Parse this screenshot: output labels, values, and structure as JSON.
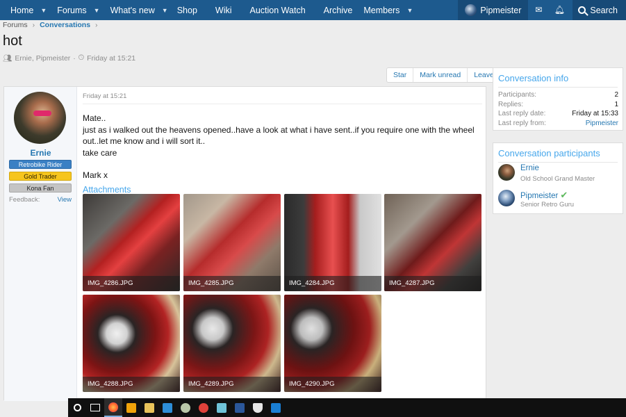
{
  "nav": {
    "items": [
      {
        "label": "Home",
        "dropdown": true
      },
      {
        "label": "Forums",
        "dropdown": true
      },
      {
        "label": "What's new",
        "dropdown": true
      },
      {
        "label": "Shop",
        "dropdown": false
      },
      {
        "label": "Wiki",
        "dropdown": false
      },
      {
        "label": "Auction Watch",
        "dropdown": false
      },
      {
        "label": "Archive",
        "dropdown": false
      },
      {
        "label": "Members",
        "dropdown": true
      }
    ],
    "user": "Pipmeister",
    "search": "Search"
  },
  "breadcrumb": {
    "forums": "Forums",
    "conversations": "Conversations"
  },
  "title": "hot",
  "meta": {
    "participants": "Ernie, Pipmeister",
    "sep": "·",
    "date": "Friday at 15:21"
  },
  "actions": {
    "star": "Star",
    "mark_unread": "Mark unread",
    "leave": "Leave"
  },
  "message": {
    "author": "Ernie",
    "badges": [
      "Retrobike Rider",
      "Gold Trader",
      "Kona Fan"
    ],
    "feedback_label": "Feedback:",
    "feedback_link": "View",
    "date": "Friday at 15:21",
    "lines": [
      "Mate..",
      "just as i walked out the heavens opened..have a look at what i have sent..if you require one with the wheel out..let me know and i will sort it..",
      "take care",
      "",
      "Mark x"
    ],
    "attachments_title": "Attachments",
    "attachments": [
      "IMG_4286.JPG",
      "IMG_4285.JPG",
      "IMG_4284.JPG",
      "IMG_4287.JPG",
      "IMG_4288.JPG",
      "IMG_4289.JPG",
      "IMG_4290.JPG"
    ]
  },
  "info": {
    "title": "Conversation info",
    "rows": [
      {
        "k": "Participants:",
        "v": "2"
      },
      {
        "k": "Replies:",
        "v": "1"
      },
      {
        "k": "Last reply date:",
        "v": "Friday at 15:33"
      },
      {
        "k": "Last reply from:",
        "v": "Pipmeister"
      }
    ]
  },
  "participants": {
    "title": "Conversation participants",
    "list": [
      {
        "name": "Ernie",
        "title": "Old School Grand Master"
      },
      {
        "name": "Pipmeister",
        "title": "Senior Retro Guru"
      }
    ]
  },
  "colors": {
    "nav": "#1d5a8e",
    "link": "#2577b1",
    "accent": "#47a7eb"
  },
  "taskbar_icons": [
    "cortana-circle-icon",
    "task-view-icon",
    "firefox-icon",
    "outlook-icon",
    "file-explorer-icon",
    "photos-icon",
    "chrome-like-icon",
    "pen-app-icon",
    "notes-icon",
    "word-icon",
    "shield-icon",
    "app-icon"
  ]
}
